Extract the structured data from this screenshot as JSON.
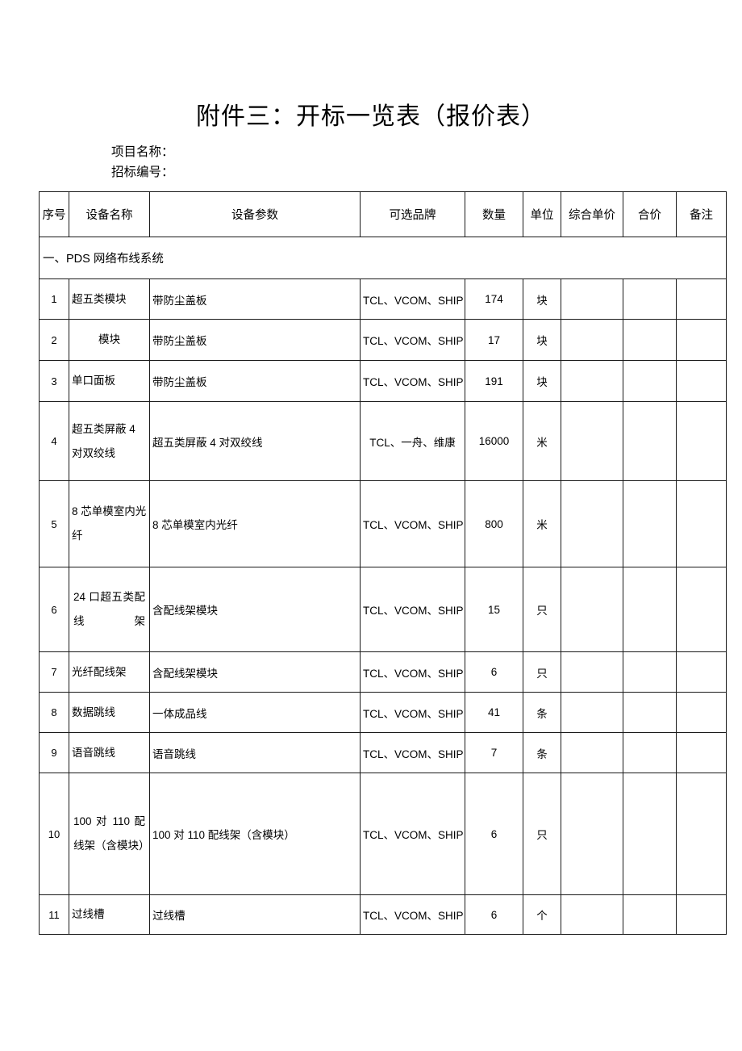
{
  "document": {
    "title": "附件三：开标一览表（报价表）",
    "meta": {
      "project_name_label": "项目名称：",
      "bid_number_label": "招标编号："
    }
  },
  "table": {
    "headers": [
      "序号",
      "设备名称",
      "设备参数",
      "可选品牌",
      "数量",
      "单位",
      "综合单价",
      "合价",
      "备注"
    ],
    "sections": [
      {
        "title": "一、PDS 网络布线系统",
        "rows": [
          {
            "index": "1",
            "name": "超五类模块",
            "name_align": "left",
            "param": "带防尘盖板",
            "brand": "TCL、VCOM、SHIP",
            "qty": "174",
            "unit": "块",
            "unit_price": "",
            "total_price": "",
            "note": ""
          },
          {
            "index": "2",
            "name": "模块",
            "name_align": "center",
            "param": "带防尘盖板",
            "brand": "TCL、VCOM、SHIP",
            "qty": "17",
            "unit": "块",
            "unit_price": "",
            "total_price": "",
            "note": ""
          },
          {
            "index": "3",
            "name": "单口面板",
            "name_align": "left",
            "param": "带防尘盖板",
            "brand": "TCL、VCOM、SHIP",
            "qty": "191",
            "unit": "块",
            "unit_price": "",
            "total_price": "",
            "note": ""
          },
          {
            "index": "4",
            "name": "超五类屏蔽 4 对双绞线",
            "name_align": "left",
            "param": "超五类屏蔽 4 对双绞线",
            "brand": "TCL、一舟、维康",
            "qty": "16000",
            "unit": "米",
            "unit_price": "",
            "total_price": "",
            "note": ""
          },
          {
            "index": "5",
            "name": "8 芯单模室内光纤",
            "name_align": "left",
            "param": "8 芯单模室内光纤",
            "brand": "TCL、VCOM、SHIP",
            "qty": "800",
            "unit": "米",
            "unit_price": "",
            "total_price": "",
            "note": ""
          },
          {
            "index": "6",
            "name": "24 口超五类配线架",
            "name_align": "justify",
            "param": "含配线架模块",
            "brand": "TCL、VCOM、SHIP",
            "qty": "15",
            "unit": "只",
            "unit_price": "",
            "total_price": "",
            "note": ""
          },
          {
            "index": "7",
            "name": "光纤配线架",
            "name_align": "left",
            "param": "含配线架模块",
            "brand": "TCL、VCOM、SHIP",
            "qty": "6",
            "unit": "只",
            "unit_price": "",
            "total_price": "",
            "note": ""
          },
          {
            "index": "8",
            "name": "数据跳线",
            "name_align": "left",
            "param": "一体成品线",
            "brand": "TCL、VCOM、SHIP",
            "qty": "41",
            "unit": "条",
            "unit_price": "",
            "total_price": "",
            "note": ""
          },
          {
            "index": "9",
            "name": "语音跳线",
            "name_align": "left",
            "param": "语音跳线",
            "brand": "TCL、VCOM、SHIP",
            "qty": "7",
            "unit": "条",
            "unit_price": "",
            "total_price": "",
            "note": ""
          },
          {
            "index": "10",
            "name": "100 对 110 配线架（含模块）",
            "name_align": "justify",
            "param": "100 对 110 配线架（含模块）",
            "brand": "TCL、VCOM、SHIP",
            "qty": "6",
            "unit": "只",
            "unit_price": "",
            "total_price": "",
            "note": ""
          },
          {
            "index": "11",
            "name": "过线槽",
            "name_align": "left",
            "param": "过线槽",
            "brand": "TCL、VCOM、SHIP",
            "qty": "6",
            "unit": "个",
            "unit_price": "",
            "total_price": "",
            "note": ""
          }
        ]
      }
    ]
  }
}
